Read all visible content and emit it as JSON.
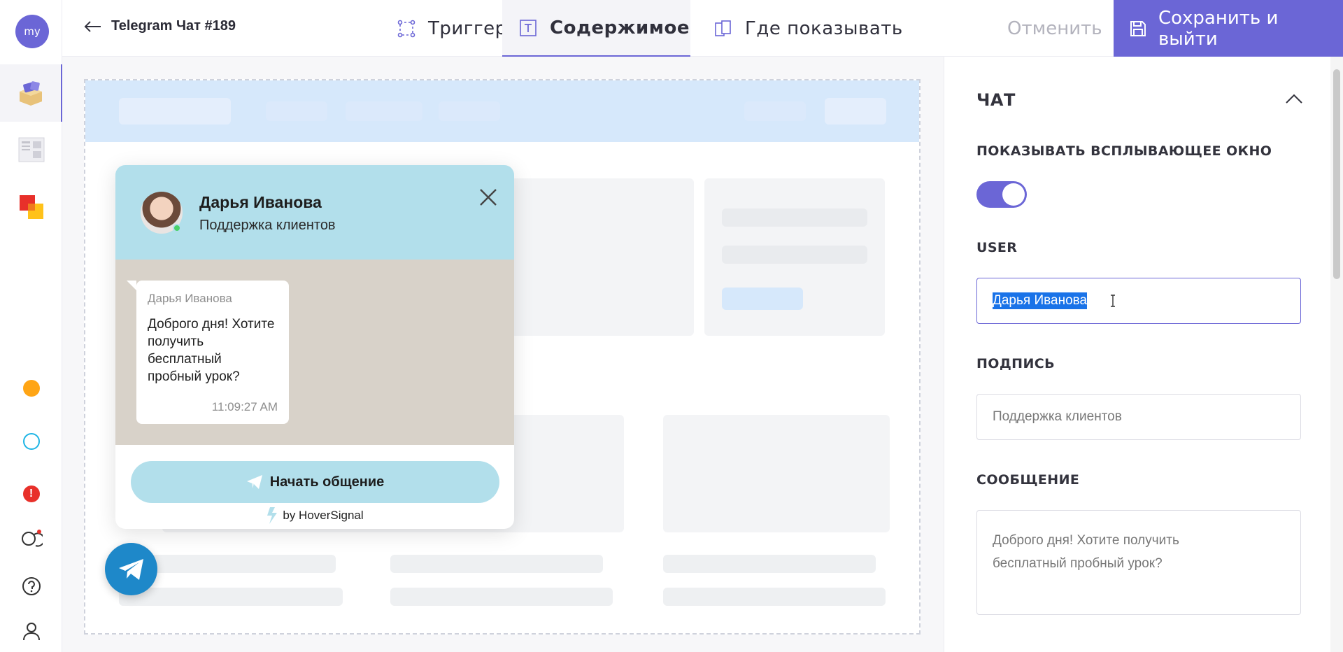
{
  "user_avatar": "my",
  "header": {
    "back_icon": "arrow-left-icon",
    "title": "Telegram Чат #189",
    "tabs": [
      {
        "label": "Триггер",
        "icon": "trigger-icon"
      },
      {
        "label": "Содержимое",
        "icon": "text-icon",
        "active": true
      },
      {
        "label": "Где показывать",
        "icon": "pages-icon"
      }
    ],
    "cancel_label": "Отменить",
    "save_label": "Сохранить и выйти"
  },
  "sidebar": {
    "icons": [
      "widgets-icon",
      "page-icon",
      "shapes-icon",
      "orange-dot-icon",
      "circle-icon",
      "alert-icon",
      "chat-icon",
      "help-icon",
      "user-icon"
    ]
  },
  "widget": {
    "agent_name": "Дарья Иванова",
    "agent_subtitle": "Поддержка клиентов",
    "message_author": "Дарья Иванова",
    "message_text": "Доброго дня! Хотите получить бесплатный пробный урок?",
    "message_time": "11:09:27 AM",
    "button_label": "Начать общение",
    "branding": "by HoverSignal"
  },
  "panel": {
    "section_title": "ЧАТ",
    "show_popup_label": "ПОКАЗЫВАТЬ ВСПЛЫВАЮЩЕЕ ОКНО",
    "show_popup_enabled": true,
    "user_label": "USER",
    "user_value": "Дарья Иванова",
    "signature_label": "ПОДПИСЬ",
    "signature_value": "Поддержка клиентов",
    "message_label": "СООБЩЕНИЕ",
    "message_value": "Доброго дня! Хотите получить бесплатный пробный урок?"
  },
  "colors": {
    "accent": "#6b66d6",
    "widget_header": "#b2dfeb",
    "telegram_blue": "#1e88c9"
  }
}
